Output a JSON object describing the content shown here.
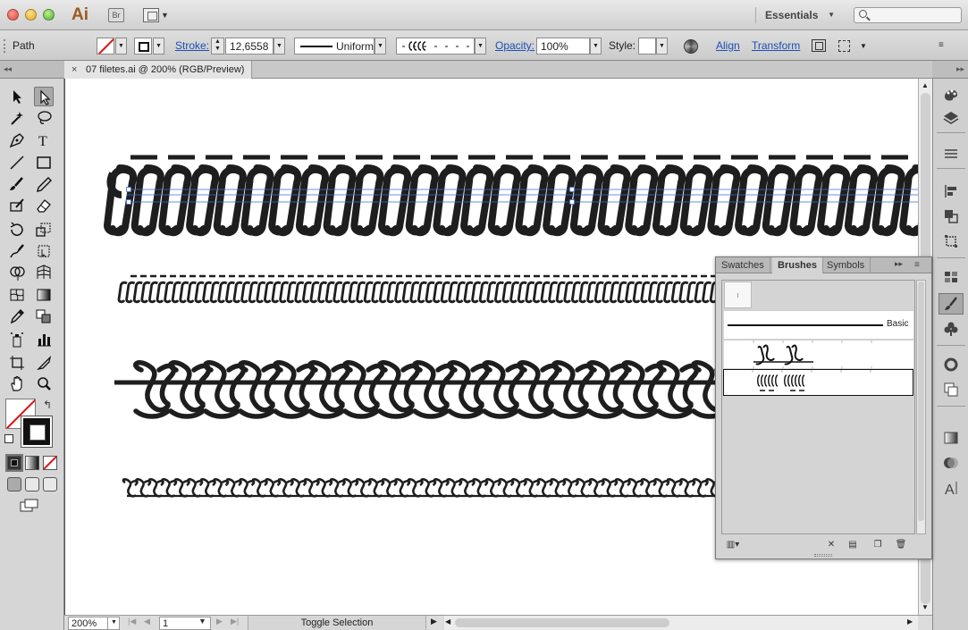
{
  "titlebar": {
    "app_logo": "Ai",
    "bridge_label": "Br",
    "workspace": "Essentials",
    "search_placeholder": ""
  },
  "control_bar": {
    "selection_type": "Path",
    "stroke_label": "Stroke:",
    "stroke_weight": "12,6558",
    "profile": "Uniform",
    "opacity_label": "Opacity:",
    "opacity_value": "100%",
    "style_label": "Style:",
    "align_label": "Align",
    "transform_label": "Transform"
  },
  "document": {
    "tab_title": "07 filetes.ai @ 200% (RGB/Preview)",
    "close_glyph": "×"
  },
  "status_bar": {
    "zoom": "200%",
    "page": "1",
    "status_text": "Toggle Selection"
  },
  "brushes_panel": {
    "tabs": [
      {
        "label": "Swatches",
        "active": false
      },
      {
        "label": "Brushes",
        "active": true
      },
      {
        "label": "Symbols",
        "active": false
      }
    ],
    "basic_label": "Basic",
    "selected_brush_index": 2
  },
  "colors": {
    "canvas": "#ffffff",
    "ink": "#1e1e1e",
    "selection": "#3b6fd6",
    "link": "#1d4fb3",
    "none_red": "#e01010"
  },
  "icons": {
    "tools": [
      "selection-tool",
      "direct-selection-tool",
      "magic-wand-tool",
      "lasso-tool",
      "pen-tool",
      "type-tool",
      "line-segment-tool",
      "rectangle-tool",
      "paintbrush-tool",
      "pencil-tool",
      "blob-brush-tool",
      "eraser-tool",
      "rotate-tool",
      "scale-tool",
      "warp-tool",
      "free-transform-tool",
      "shape-builder-tool",
      "perspective-grid-tool",
      "mesh-tool",
      "gradient-tool",
      "eyedropper-tool",
      "blend-tool",
      "symbol-sprayer-tool",
      "column-graph-tool",
      "artboard-tool",
      "slice-tool",
      "hand-tool",
      "zoom-tool"
    ],
    "dock": [
      "color-guide-icon",
      "layers-icon",
      "align-panel-icon",
      "artboards-icon",
      "pathfinder-icon",
      "transform-panel-icon",
      "swatches-icon",
      "brushes-icon",
      "symbols-icon",
      "stroke-icon",
      "appearance-icon",
      "gradient-icon",
      "transparency-icon",
      "character-icon"
    ]
  }
}
